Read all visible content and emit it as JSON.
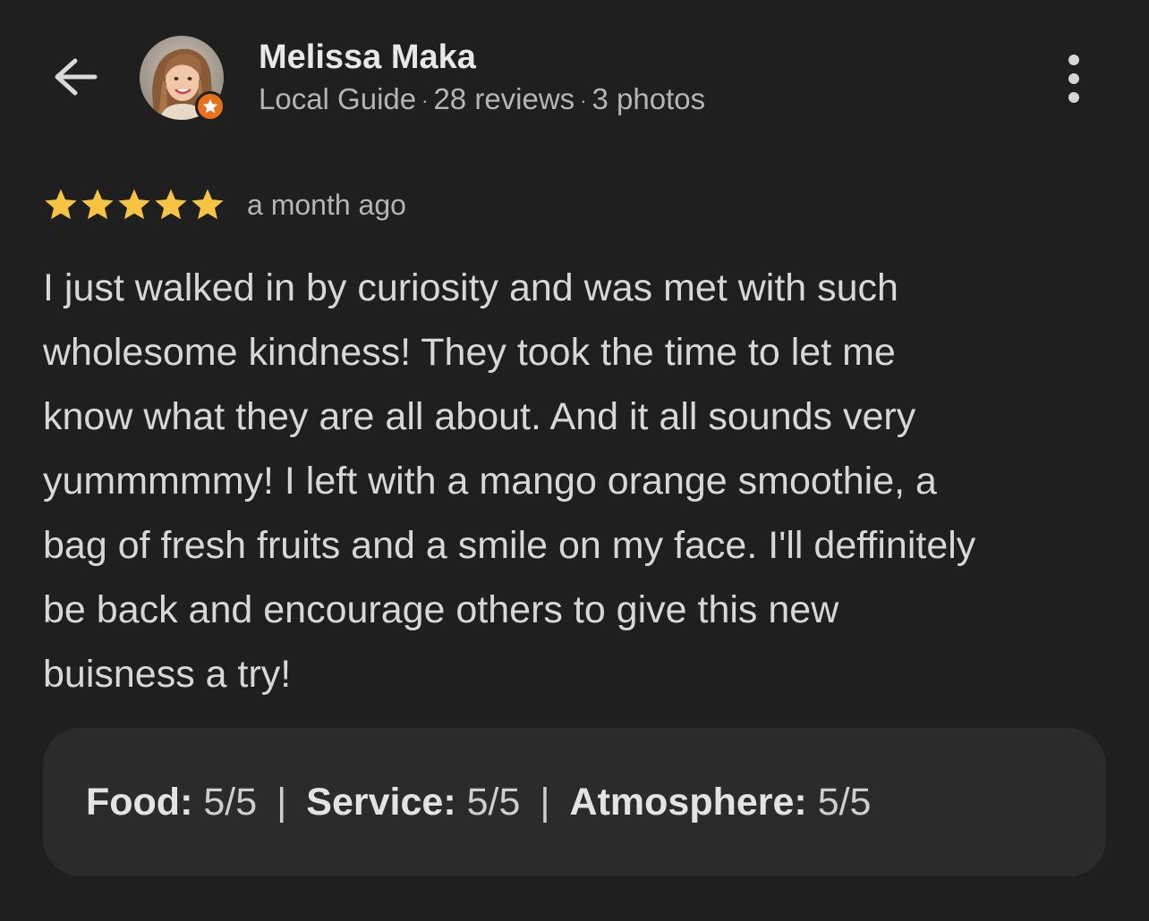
{
  "header": {
    "back_icon": "arrow-left-icon",
    "more_icon": "more-vert-icon",
    "avatar_icon": "profile-photo",
    "badge_icon": "local-guide-star-icon"
  },
  "author": {
    "name": "Melissa Maka",
    "role": "Local Guide",
    "separator": "·",
    "reviews": "28 reviews",
    "photos": "3 photos"
  },
  "review": {
    "rating": 5,
    "rating_max": 5,
    "time_ago": "a month ago",
    "text_lines": [
      "I just walked in by curiosity and was met with such",
      "wholesome kindness! They took the time to let me",
      "know what they are all about. And it all sounds very",
      "yummmmmy! I left with a mango orange smoothie, a",
      "bag of fresh fruits and a smile on my face. I'll deffinitely",
      "be back and encourage others to give this new",
      "buisness a try!"
    ]
  },
  "attributes": {
    "separator": "|",
    "items": [
      {
        "label": "Food:",
        "value": "5/5"
      },
      {
        "label": "Service:",
        "value": "5/5"
      },
      {
        "label": "Atmosphere:",
        "value": "5/5"
      }
    ]
  },
  "colors": {
    "background": "#1f1f1f",
    "star": "#f6c343",
    "badge": "#e8711a",
    "card": "#2b2b2d"
  }
}
